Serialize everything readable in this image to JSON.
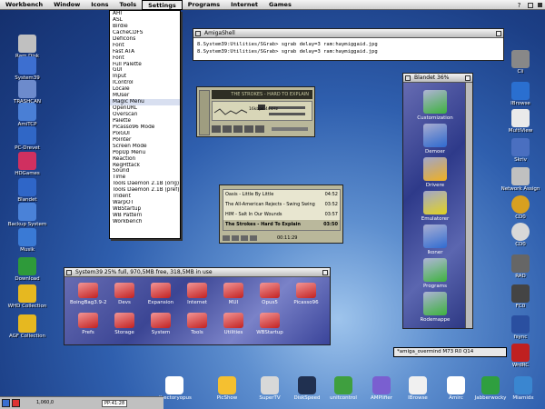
{
  "menubar": {
    "items": [
      {
        "label": "Workbench"
      },
      {
        "label": "Window"
      },
      {
        "label": "Icons"
      },
      {
        "label": "Tools"
      },
      {
        "label": "Settings"
      },
      {
        "label": "Programs"
      },
      {
        "label": "Internet"
      },
      {
        "label": "Games"
      }
    ]
  },
  "settings_menu": {
    "items": [
      "AHI",
      "ASL",
      "Birdie",
      "CacheCDFS",
      "DefIcons",
      "Font",
      "Fast ATA",
      "Font",
      "Full Palette",
      "GUI",
      "Input",
      "IControl",
      "Locale",
      "MUser",
      "Magic Menu",
      "OpenURL",
      "Overscan",
      "Palette",
      "Picasso96 Mode",
      "PixGUI",
      "Pointer",
      "Screen Mode",
      "PopUp Menu",
      "Reaction",
      "RegHttack",
      "Sound",
      "Time",
      "Tools Daemon 2.1B (orig)",
      "Tools Daemon 2.1B (pref)",
      "Trident",
      "WarpOT",
      "WBStartup",
      "WB Pattern",
      "Workbench"
    ],
    "highlighted_index": 14
  },
  "left_icons": [
    {
      "label": "Ram Disk",
      "icon": "ram-disk-icon",
      "color": "#c0c0c0"
    },
    {
      "label": "System39",
      "icon": "harddisk-icon",
      "color": "#3d6fd0"
    },
    {
      "label": "TRASHCAN",
      "icon": "trashcan-icon",
      "color": "#6d8bcc"
    },
    {
      "label": "AmiTCP",
      "icon": "network-icon",
      "color": "#4a7fd5"
    },
    {
      "label": "PC-Drevet",
      "icon": "pc-drive-icon",
      "color": "#3067c6"
    },
    {
      "label": "HDGames",
      "icon": "games-heart-icon",
      "color": "#d03060"
    },
    {
      "label": "Blandet",
      "icon": "blandet-icon",
      "color": "#2f66c8"
    },
    {
      "label": "Backup System",
      "icon": "backup-icon",
      "color": "#4a82d8"
    },
    {
      "label": "Musik",
      "icon": "music-icon",
      "color": "#3a7ad5"
    },
    {
      "label": "Download",
      "icon": "download-icon",
      "color": "#2e9a3a"
    },
    {
      "label": "WHD Collection",
      "icon": "whd-box-icon",
      "color": "#e6b820"
    },
    {
      "label": "AGF Collection",
      "icon": "agf-box-icon",
      "color": "#e6b820"
    }
  ],
  "right_icons": [
    {
      "label": "Cli",
      "icon": "cli-icon"
    },
    {
      "label": "IBrowse",
      "icon": "ibrowse-icon"
    },
    {
      "label": "MultiView",
      "icon": "multiview-icon"
    },
    {
      "label": "Skriv",
      "icon": "write-icon"
    },
    {
      "label": "Network Assign",
      "icon": "network-assign-icon"
    },
    {
      "label": "CD0",
      "icon": "cd-icon"
    },
    {
      "label": "CD0",
      "icon": "cd-icon"
    },
    {
      "label": "RAD",
      "icon": "rad-icon"
    },
    {
      "label": "FC0",
      "icon": "fc0-icon"
    },
    {
      "label": "fsync",
      "icon": "fsync-icon"
    },
    {
      "label": "WrdRC",
      "icon": "wrdrc-icon"
    }
  ],
  "shell": {
    "title": "AmigaShell",
    "lines": [
      "8.System39:Utilities/SGrab> sgrab delay=3 ram:haymiggaid.jpg",
      "8.System39:Utilities/SGrab> sgrab delay=3 ram:haymiggaid.jpg"
    ]
  },
  "player": {
    "title": "THE STROKES - HARD TO EXPLAIN",
    "mini": "16kbps 44kHz"
  },
  "playlist": {
    "items": [
      {
        "title": "Oasis - Little By Little",
        "time": "04:52"
      },
      {
        "title": "The All-American Rejects - Swing Swing",
        "time": "03:52"
      },
      {
        "title": "HIM - Salt In Our Wounds",
        "time": "03:57"
      },
      {
        "title": "The Strokes - Hard To Explain",
        "time": "03:50"
      }
    ],
    "footer": "00:11:29"
  },
  "drawer": {
    "title": "Blandet 36%",
    "items": [
      {
        "label": "Customization",
        "color": "#3fb33f"
      },
      {
        "label": "Demoer",
        "color": "#2f6ad0"
      },
      {
        "label": "Drivere",
        "color": "#f0b020"
      },
      {
        "label": "Emulatorer",
        "color": "#e0d020"
      },
      {
        "label": "Ikoner",
        "color": "#2f6ad0"
      },
      {
        "label": "Programs",
        "color": "#3fb33f"
      },
      {
        "label": "Rodemappe",
        "color": "#3fb33f"
      }
    ]
  },
  "system39": {
    "title": "System39  25% full, 970,5MB free, 318,5MB in use",
    "items": [
      "BoingBag3.9-2",
      "Devs",
      "Expansion",
      "Internet",
      "MUI",
      "Opus5",
      "Picasso96",
      "Prefs",
      "Storage",
      "System",
      "Tools",
      "Utilities",
      "WBStartup"
    ]
  },
  "chat": {
    "text": "*amiga_overmind M73 R0 Q14"
  },
  "dock": {
    "items": [
      {
        "label": "directoryopus",
        "icon": "dopus-icon",
        "color": "#ffffff"
      },
      {
        "label": "PicShow",
        "icon": "picshow-icon",
        "color": "#f5c030"
      },
      {
        "label": "SuperTV",
        "icon": "supertv-icon",
        "color": "#d8d8d8"
      },
      {
        "label": "DiskSpeed",
        "icon": "diskspeed-icon",
        "color": "#203050"
      },
      {
        "label": "unitcontrol",
        "icon": "unitcontrol-icon",
        "color": "#3f9f3f"
      },
      {
        "label": "AMPlifier",
        "icon": "amplifier-icon",
        "color": "#7a5fd0"
      },
      {
        "label": "IBrowse",
        "icon": "ibrowse-icon",
        "color": "#f0f0f0"
      },
      {
        "label": "Amirc",
        "icon": "amirc-icon",
        "color": "#ffffff"
      },
      {
        "label": "Jabberwocky",
        "icon": "jabber-icon",
        "color": "#2f9f3f"
      },
      {
        "label": "Miamidx",
        "icon": "miami-icon",
        "color": "#3a86d0"
      }
    ]
  },
  "taskbar": {
    "mem": "1,060,0",
    "clock": "PP:41:28"
  }
}
